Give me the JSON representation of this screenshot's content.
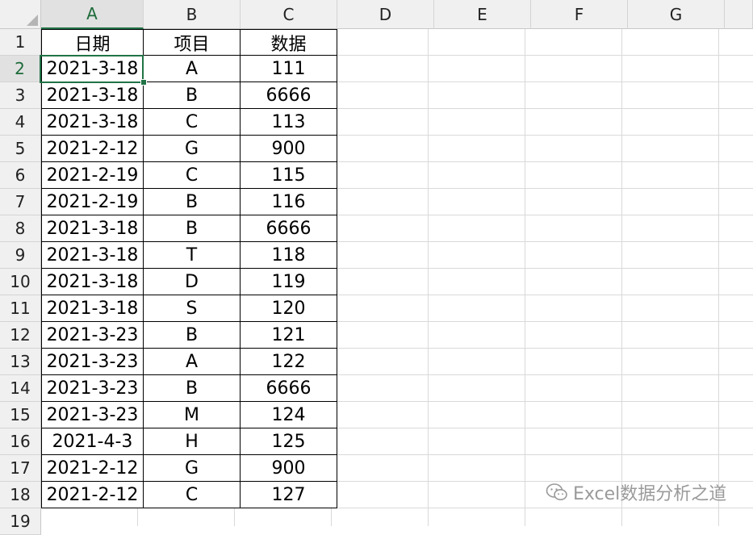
{
  "columns": [
    "A",
    "B",
    "C",
    "D",
    "E",
    "F",
    "G"
  ],
  "rows": [
    "1",
    "2",
    "3",
    "4",
    "5",
    "6",
    "7",
    "8",
    "9",
    "10",
    "11",
    "12",
    "13",
    "14",
    "15",
    "16",
    "17",
    "18",
    "19"
  ],
  "selected_cell": "A2",
  "table": {
    "headers": [
      "日期",
      "项目",
      "数据"
    ],
    "rows": [
      [
        "2021-3-18",
        "A",
        "111"
      ],
      [
        "2021-3-18",
        "B",
        "6666"
      ],
      [
        "2021-3-18",
        "C",
        "113"
      ],
      [
        "2021-2-12",
        "G",
        "900"
      ],
      [
        "2021-2-19",
        "C",
        "115"
      ],
      [
        "2021-2-19",
        "B",
        "116"
      ],
      [
        "2021-3-18",
        "B",
        "6666"
      ],
      [
        "2021-3-18",
        "T",
        "118"
      ],
      [
        "2021-3-18",
        "D",
        "119"
      ],
      [
        "2021-3-18",
        "S",
        "120"
      ],
      [
        "2021-3-23",
        "B",
        "121"
      ],
      [
        "2021-3-23",
        "A",
        "122"
      ],
      [
        "2021-3-23",
        "B",
        "6666"
      ],
      [
        "2021-3-23",
        "M",
        "124"
      ],
      [
        "2021-4-3",
        "H",
        "125"
      ],
      [
        "2021-2-12",
        "G",
        "900"
      ],
      [
        "2021-2-12",
        "C",
        "127"
      ]
    ]
  },
  "watermark": {
    "icon": "wechat-icon",
    "text": "Excel数据分析之道"
  },
  "colors": {
    "accent": "#217346",
    "header_bg": "#f0f0f0"
  }
}
